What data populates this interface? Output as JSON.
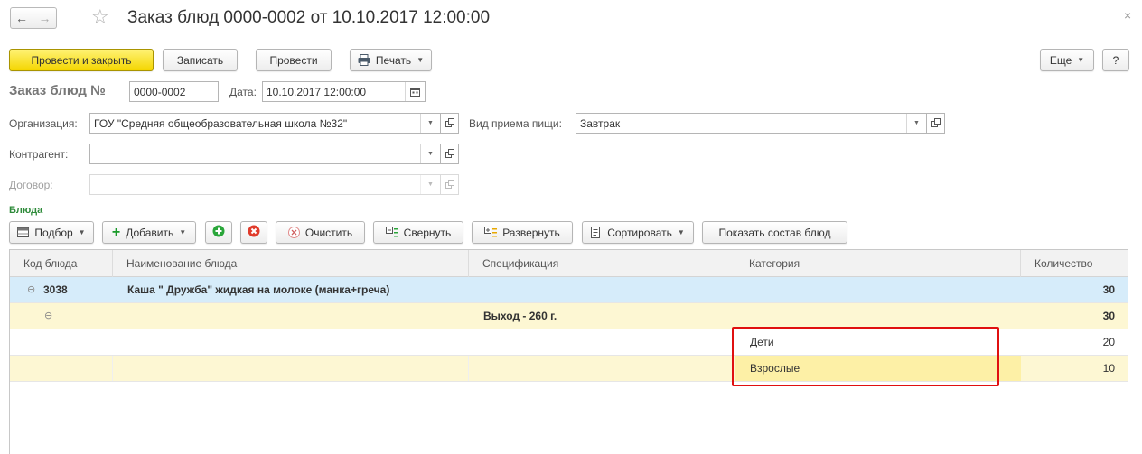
{
  "window": {
    "title": "Заказ блюд 0000-0002 от 10.10.2017 12:00:00",
    "nav_back": "←",
    "nav_forward": "→",
    "star": "☆",
    "close": "×"
  },
  "toolbar": {
    "post_close": "Провести и закрыть",
    "save": "Записать",
    "post": "Провести",
    "print": "Печать",
    "more": "Еще",
    "help": "?"
  },
  "header": {
    "doc_label": "Заказ блюд №",
    "doc_number": "0000-0002",
    "date_label": "Дата:",
    "date_value": "10.10.2017 12:00:00"
  },
  "form": {
    "org_label": "Организация:",
    "org_value": "ГОУ \"Средняя общеобразовательная школа №32\"",
    "meal_label": "Вид приема пищи:",
    "meal_value": "Завтрак",
    "contractor_label": "Контрагент:",
    "contractor_value": "",
    "contract_label": "Договор:",
    "contract_value": ""
  },
  "dishes": {
    "section_title": "Блюда",
    "toolbar": {
      "pick": "Подбор",
      "add": "Добавить",
      "clear": "Очистить",
      "collapse": "Свернуть",
      "expand": "Развернуть",
      "sort": "Сортировать",
      "show_composition": "Показать состав блюд"
    },
    "columns": [
      "Код блюда",
      "Наименование блюда",
      "Спецификация",
      "Категория",
      "Количество"
    ],
    "rows": [
      {
        "toggle": "⊖",
        "code": "3038",
        "name": "Каша \" Дружба\"  жидкая на молоке (манка+греча)",
        "spec": "",
        "category": "",
        "qty": "30"
      },
      {
        "toggle": "⊖",
        "code": "",
        "name": "",
        "spec": "Выход - 260 г.",
        "category": "",
        "qty": "30"
      },
      {
        "toggle": "",
        "code": "",
        "name": "",
        "spec": "",
        "category": "Дети",
        "qty": "20"
      },
      {
        "toggle": "",
        "code": "",
        "name": "",
        "spec": "",
        "category": "Взрослые",
        "qty": "10"
      }
    ]
  },
  "colors": {
    "primary_button": "#f4d600",
    "group_row": "#d6ecfa",
    "sub_row": "#fdf7d3",
    "selected_cell": "#fdf0a6",
    "highlight_border": "#e01010",
    "section_green": "#2e8b3a"
  }
}
